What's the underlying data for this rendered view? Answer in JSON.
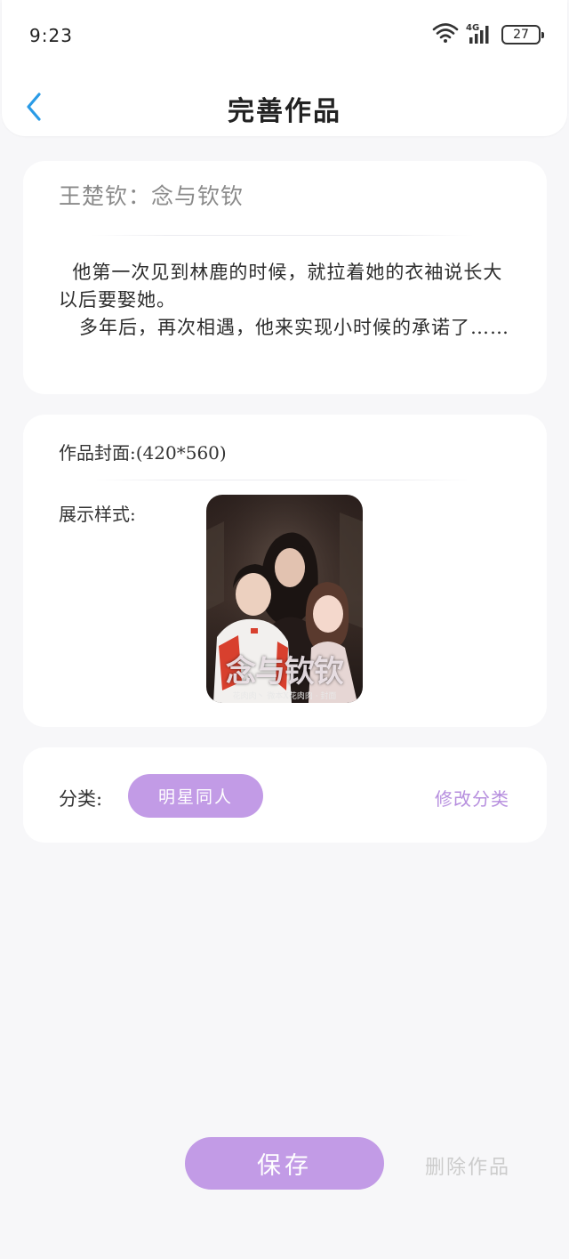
{
  "status_bar": {
    "time": "9:23",
    "network": "4G",
    "battery": "27",
    "icons": [
      "wifi-icon",
      "signal-icon",
      "battery-icon"
    ]
  },
  "nav": {
    "back_icon": "chevron-left-icon",
    "title": "完善作品"
  },
  "work": {
    "title": "王楚钦：念与钦钦",
    "description": "  他第一次见到林鹿的时候，就拉着她的衣袖说长大以后要娶她。\n   多年后，再次相遇，他来实现小时候的承诺了……"
  },
  "cover": {
    "label": "作品封面:(420*560)",
    "style_label": "展示样式:",
    "image_title": "念与钦钦",
    "image_credit": "花肉肉丶 微本X花肉肉 · 封面"
  },
  "category": {
    "label": "分类:",
    "value": "明星同人",
    "edit_label": "修改分类"
  },
  "actions": {
    "save_label": "保存",
    "delete_label": "删除作品"
  },
  "colors": {
    "accent": "#c29be6",
    "accent_text": "#b68ede",
    "back_arrow": "#2a9be6",
    "background": "#f7f7f9"
  }
}
